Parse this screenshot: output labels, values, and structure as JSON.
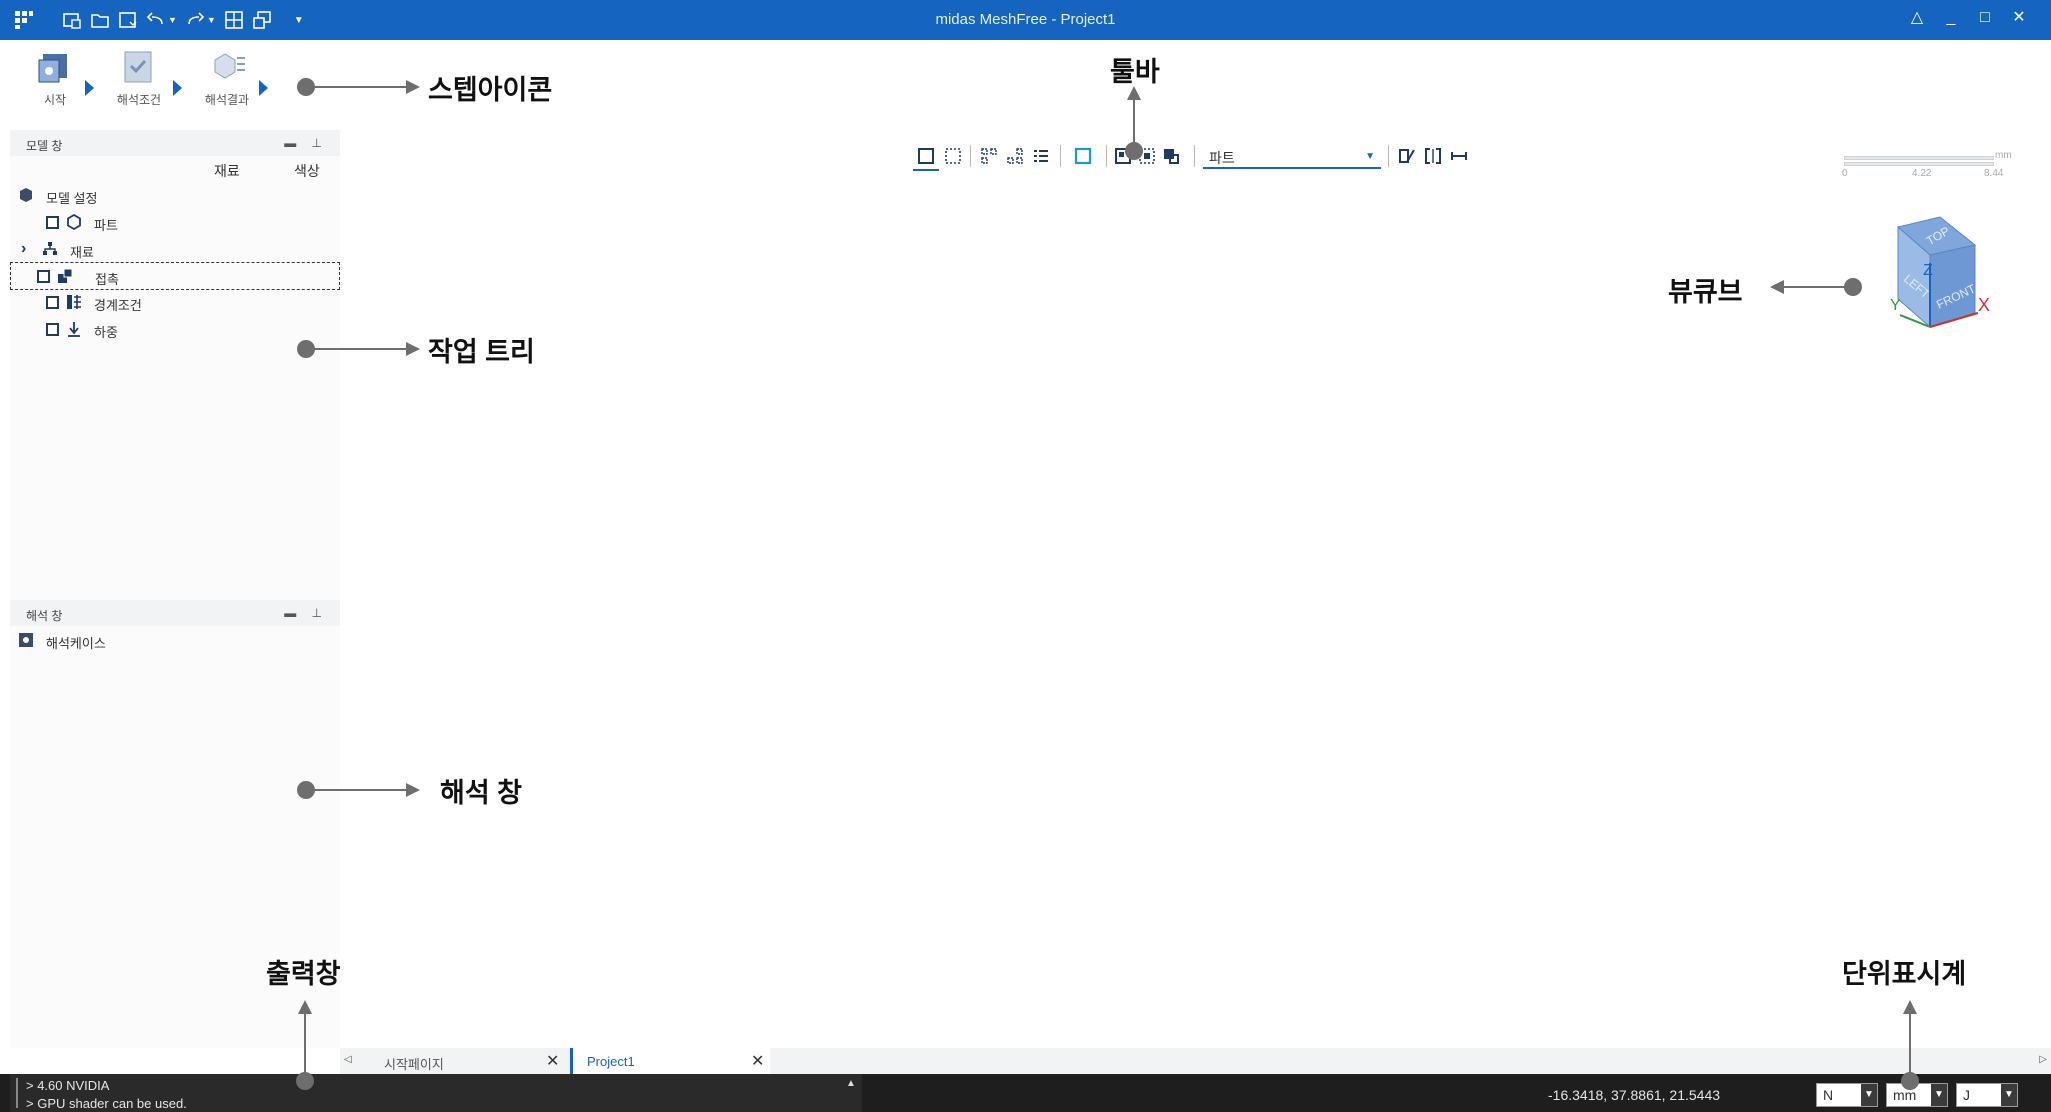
{
  "app": {
    "title": "midas MeshFree - Project1",
    "colors": {
      "titlebar": "#1565c0",
      "accent": "#1565c0",
      "statusbar": "#1e1e1e"
    }
  },
  "quick_access": [
    "app-menu-icon",
    "new-icon",
    "open-icon",
    "save-icon",
    "undo-icon",
    "redo-icon",
    "grid-icon",
    "window-icon",
    "customize-icon"
  ],
  "steps": [
    {
      "label": "시작",
      "icon": "start-step-icon"
    },
    {
      "label": "해석조건",
      "icon": "analysis-condition-step-icon"
    },
    {
      "label": "해석결과",
      "icon": "analysis-result-step-icon"
    }
  ],
  "model_panel": {
    "title": "모델 창",
    "columns": [
      "재료",
      "색상"
    ],
    "items": [
      {
        "label": "모델 설정"
      },
      {
        "label": "파트"
      },
      {
        "label": "재료"
      },
      {
        "label": "접촉"
      },
      {
        "label": "경계조건"
      },
      {
        "label": "하중"
      }
    ]
  },
  "analysis_panel": {
    "title": "해석 창",
    "items": [
      {
        "label": "해석케이스"
      }
    ]
  },
  "toolbar": {
    "select_filter": "파트"
  },
  "scale_bar": {
    "unit": "mm",
    "ticks": [
      "0",
      "4.22",
      "8.44"
    ]
  },
  "view_cube": {
    "faces": [
      "TOP",
      "LEFT",
      "FRONT"
    ],
    "axes": [
      "Z",
      "Y",
      "X"
    ]
  },
  "doc_tabs": [
    {
      "label": "시작페이지",
      "active": false
    },
    {
      "label": "Project1",
      "active": true
    }
  ],
  "output": {
    "lines": [
      "> 4.60 NVIDIA",
      "> GPU shader can be used."
    ]
  },
  "status": {
    "coordinates": "-16.3418, 37.8861, 21.5443",
    "units": {
      "force": "N",
      "length": "mm",
      "energy": "J"
    }
  },
  "annotations": {
    "step_icons": "스텝아이콘",
    "toolbar": "툴바",
    "view_cube": "뷰큐브",
    "work_tree": "작업 트리",
    "analysis_window": "해석 창",
    "output_window": "출력창",
    "unit_display": "단위표시계"
  }
}
